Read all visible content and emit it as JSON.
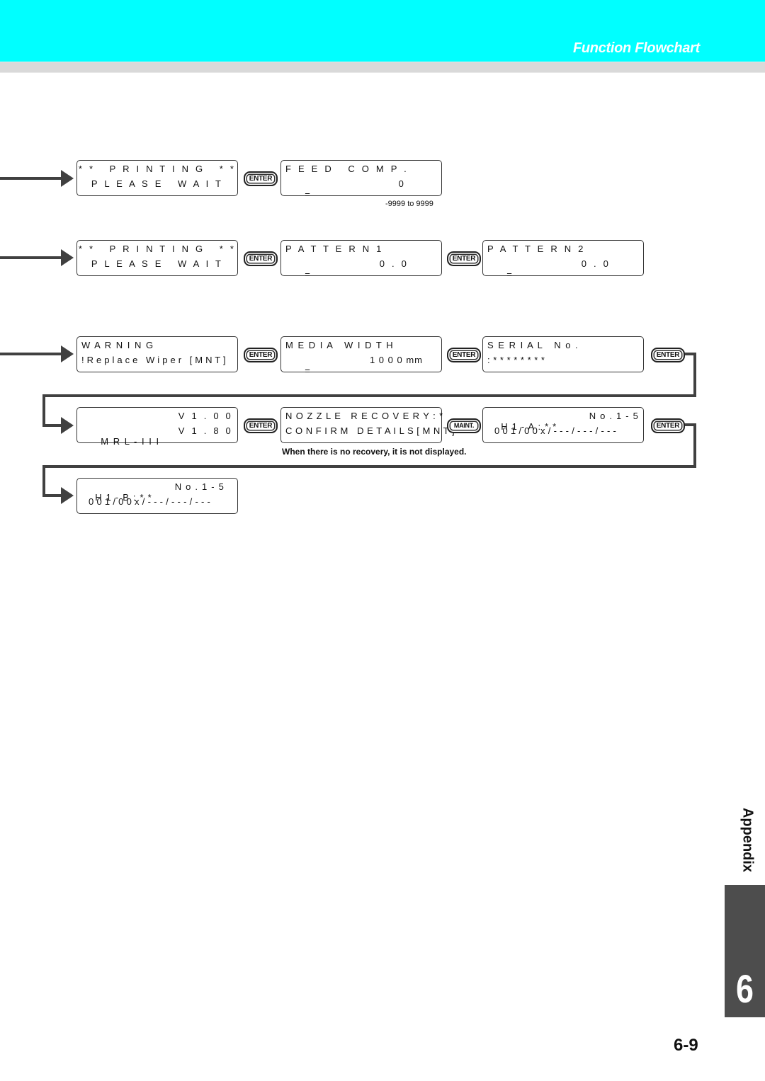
{
  "header": {
    "title": "Function Flowchart",
    "bg_color": "#00ffff"
  },
  "flow": {
    "row1": {
      "screen1": {
        "line1": "* *   P R I N T I N G   * *",
        "line2": "P L E A S E   W A I T"
      },
      "key1": "ENTER",
      "screen2": {
        "line1": "F E E D   C O M P .",
        "line2_left": "=",
        "line2_right": "0"
      },
      "range_note": "-9999 to 9999"
    },
    "row2": {
      "screen1": {
        "line1": "* *   P R I N T I N G   * *",
        "line2": "P L E A S E   W A I T"
      },
      "key1": "ENTER",
      "screen2": {
        "line1": "P A T T E R N 1",
        "line2_left": "=",
        "line2_right": "0 . 0"
      },
      "key2": "ENTER",
      "screen3": {
        "line1": "P A T T E R N 2",
        "line2_left": "=",
        "line2_right": "0 . 0"
      }
    },
    "row3": {
      "screen1": {
        "line1": "W A R N I N G",
        "line2": "! R e p l a c e   W i p e r   [ M N T ]"
      },
      "key1": "ENTER",
      "screen2": {
        "line1": "M E D I A   W I D T H",
        "line2_left": "=",
        "line2_right": "1 0 0 0 mm"
      },
      "key2": "ENTER",
      "screen3": {
        "line1": "S E R I A L   N o .",
        "line2": ": * * * * * * * *"
      },
      "key3": "ENTER"
    },
    "row4": {
      "screen1": {
        "line1_right": "V 1 . 0 0",
        "line2_left": "M R L - I I I",
        "line2_right": "V 1 . 8 0"
      },
      "key1": "ENTER",
      "screen2": {
        "line1": "N O Z Z L E   R E C O V E R Y : *",
        "line2": "C O N F I R M   D E T A I L S [ M N T ]"
      },
      "key2": "MAINT.",
      "screen3": {
        "line1_left": "H 1 - A : * *",
        "line1_right": "N o . 1 - 5",
        "line2": "0 0 1 / 0 0 x / - - - / - - - / - - -"
      },
      "key3": "ENTER",
      "note": "When there is no recovery, it is not displayed."
    },
    "row5": {
      "screen1": {
        "line1_left": "H 1 - B : * *",
        "line1_right": "N o . 1 - 5",
        "line2": "0 0 1 / 0 0 x / - - - / - - - / - - -"
      }
    }
  },
  "side_tab": {
    "label": "Appendix",
    "chapter": "6"
  },
  "page_number": "6-9"
}
